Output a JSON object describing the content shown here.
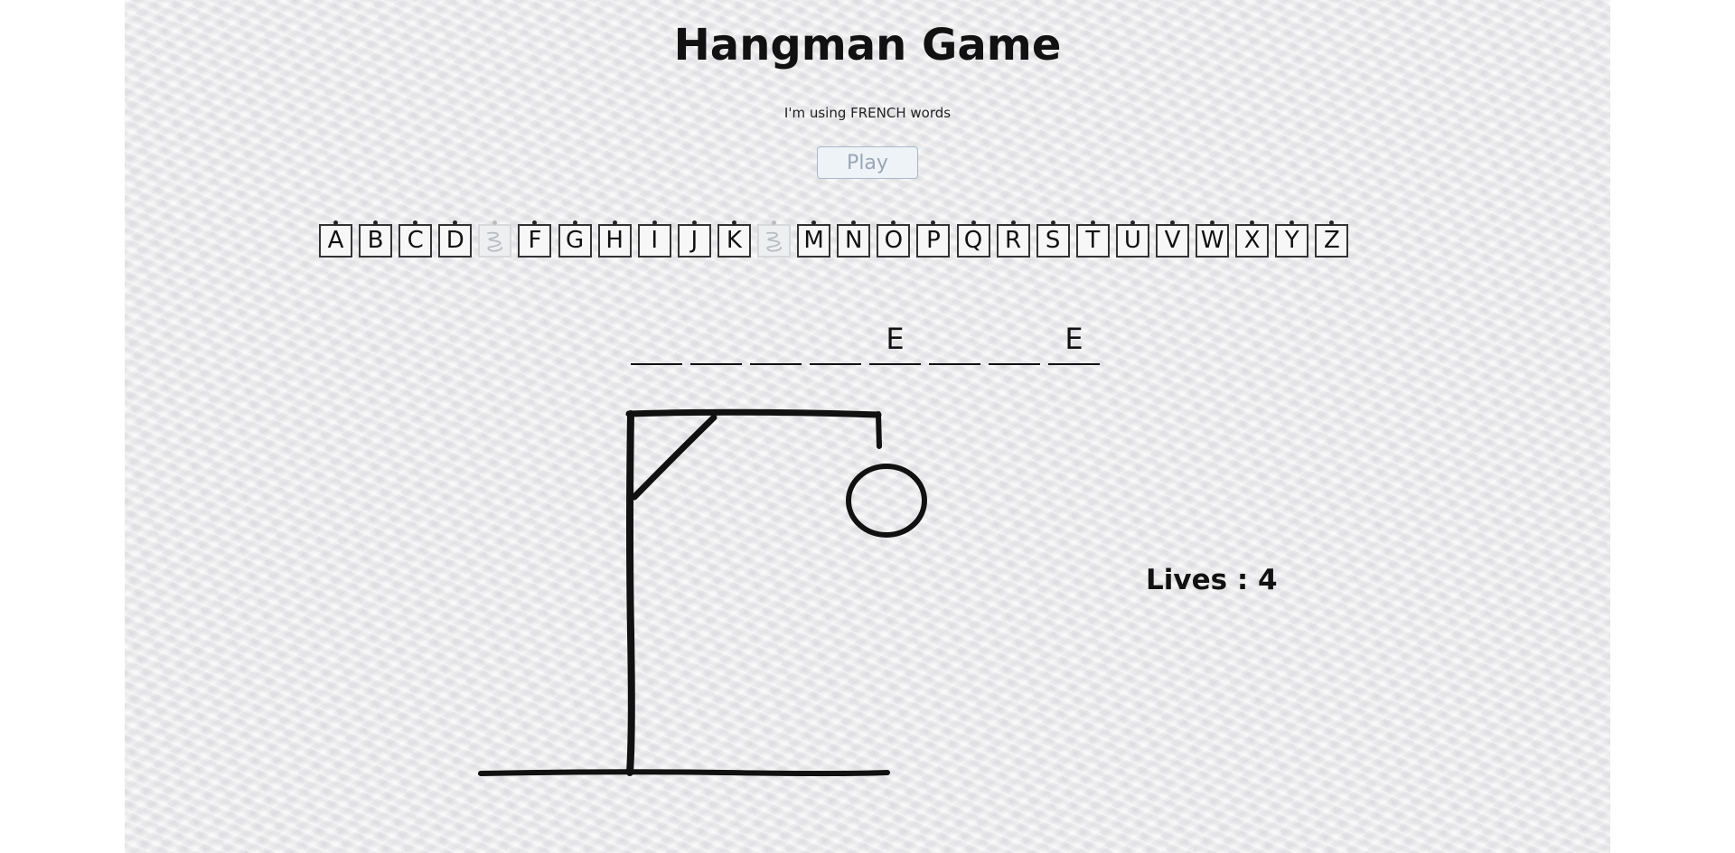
{
  "game": {
    "title": "Hangman Game",
    "subtitle": "I'm using FRENCH words",
    "play_label": "Play"
  },
  "alphabet": [
    {
      "letter": "A",
      "used": false
    },
    {
      "letter": "B",
      "used": false
    },
    {
      "letter": "C",
      "used": false
    },
    {
      "letter": "D",
      "used": false
    },
    {
      "letter": "E",
      "used": true
    },
    {
      "letter": "F",
      "used": false
    },
    {
      "letter": "G",
      "used": false
    },
    {
      "letter": "H",
      "used": false
    },
    {
      "letter": "I",
      "used": false
    },
    {
      "letter": "J",
      "used": false
    },
    {
      "letter": "K",
      "used": false
    },
    {
      "letter": "L",
      "used": true
    },
    {
      "letter": "M",
      "used": false
    },
    {
      "letter": "N",
      "used": false
    },
    {
      "letter": "O",
      "used": false
    },
    {
      "letter": "P",
      "used": false
    },
    {
      "letter": "Q",
      "used": false
    },
    {
      "letter": "R",
      "used": false
    },
    {
      "letter": "S",
      "used": false
    },
    {
      "letter": "T",
      "used": false
    },
    {
      "letter": "U",
      "used": false
    },
    {
      "letter": "V",
      "used": false
    },
    {
      "letter": "W",
      "used": false
    },
    {
      "letter": "X",
      "used": false
    },
    {
      "letter": "Y",
      "used": false
    },
    {
      "letter": "Z",
      "used": false
    }
  ],
  "word_slots": [
    "",
    "",
    "",
    "",
    "E",
    "",
    "",
    "E"
  ],
  "lives": {
    "label": "Lives : 4",
    "count": 4
  },
  "hangman_parts_drawn": [
    "base",
    "pole",
    "beam",
    "brace",
    "rope",
    "head"
  ],
  "colors": {
    "ink": "#111111",
    "paper": "#efeff0",
    "button_bg": "#eef3f8",
    "button_text": "#9aa6b2"
  }
}
